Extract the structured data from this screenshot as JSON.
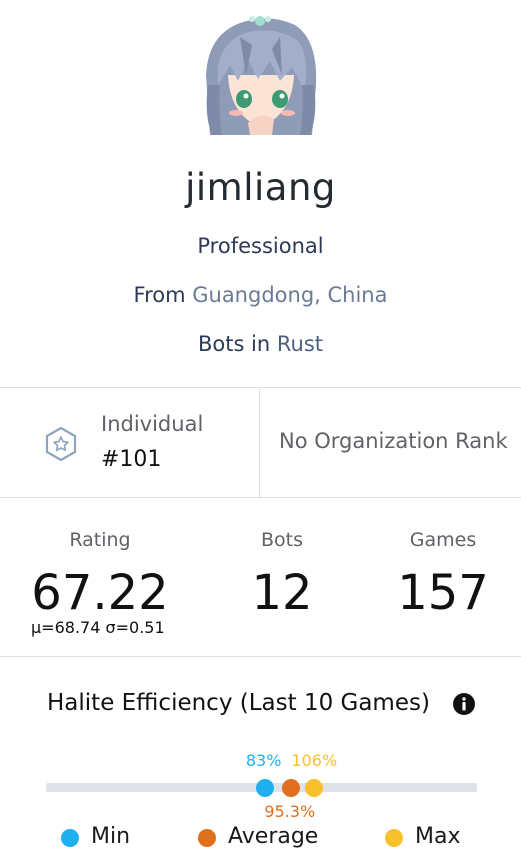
{
  "profile": {
    "username": "jimliang",
    "level": "Professional",
    "from_prefix": "From",
    "location": "Guangdong, China",
    "bots_prefix": "Bots in",
    "language": "Rust"
  },
  "rank": {
    "label": "Individual",
    "value": "#101",
    "org_rank": "No Organization Rank"
  },
  "stats": {
    "rating_label": "Rating",
    "rating_value": "67.22",
    "rating_sub": "μ=68.74 σ=0.51",
    "bots_label": "Bots",
    "bots_value": "12",
    "games_label": "Games",
    "games_value": "157"
  },
  "efficiency": {
    "title": "Halite Efficiency (Last 10 Games)",
    "min": {
      "label": "83%",
      "value": 83
    },
    "average": {
      "label": "95.3%",
      "value": 95.3
    },
    "max": {
      "label": "106%",
      "value": 106
    },
    "legend": {
      "min": "Min",
      "average": "Average",
      "max": "Max"
    },
    "colors": {
      "min": "#1fb0ef",
      "average": "#e06f1e",
      "max": "#f8c02c"
    }
  }
}
